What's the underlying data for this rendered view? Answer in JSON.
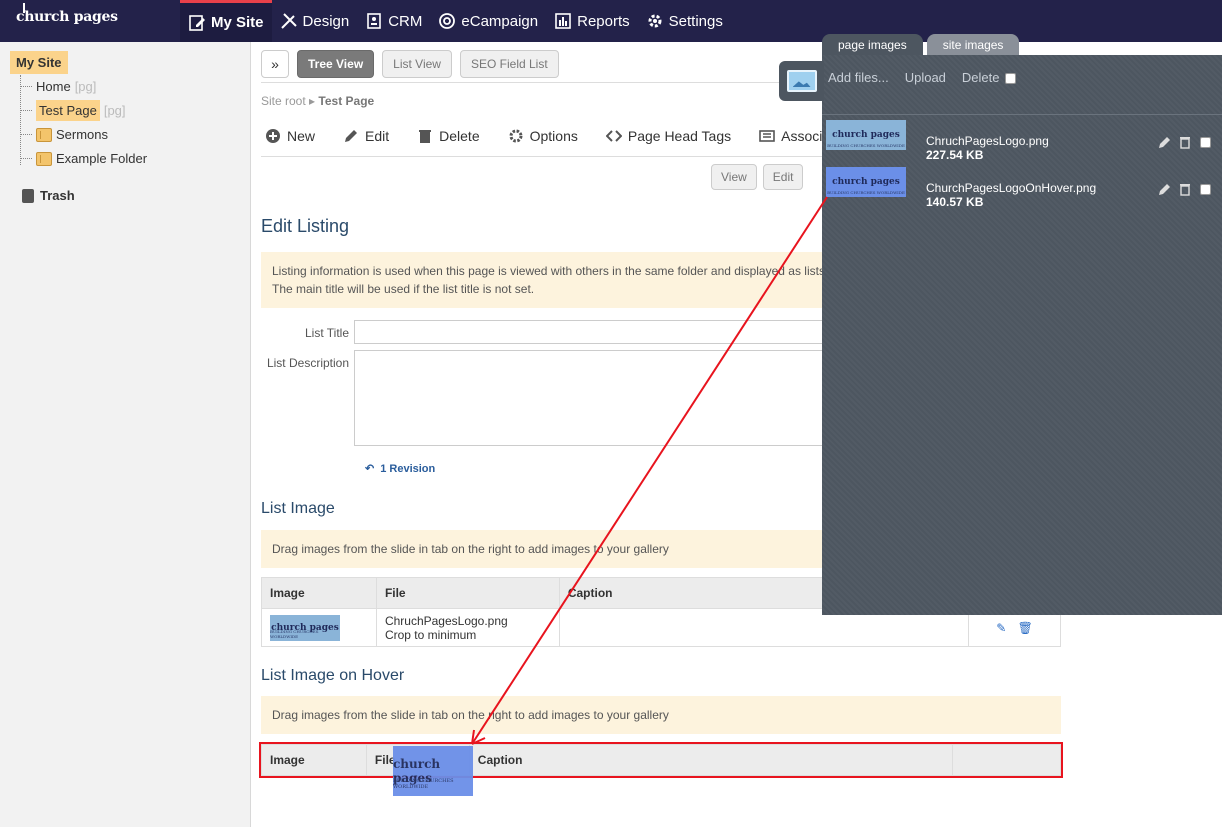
{
  "brand": {
    "name": "church pages"
  },
  "nav": [
    {
      "label": "My Site",
      "icon": "page-edit-icon",
      "active": true
    },
    {
      "label": "Design",
      "icon": "design-tools-icon"
    },
    {
      "label": "CRM",
      "icon": "address-book-icon"
    },
    {
      "label": "eCampaign",
      "icon": "at-sign-icon"
    },
    {
      "label": "Reports",
      "icon": "bar-chart-icon"
    },
    {
      "label": "Settings",
      "icon": "gear-icon"
    }
  ],
  "sidebar": {
    "root": "My Site",
    "items": [
      {
        "label": "Home",
        "tag": "[pg]"
      },
      {
        "label": "Test Page",
        "tag": "[pg]"
      },
      {
        "label": "Sermons"
      },
      {
        "label": "Example Folder"
      }
    ],
    "trash": "Trash"
  },
  "toolbar": {
    "expand": "»",
    "views": [
      "Tree View",
      "List View",
      "SEO Field List"
    ]
  },
  "breadcrumb": {
    "root": "Site root",
    "current": "Test Page"
  },
  "actions": [
    "New",
    "Edit",
    "Delete",
    "Options",
    "Page Head Tags",
    "Associate"
  ],
  "view_buttons": [
    "View",
    "Edit"
  ],
  "edit_listing": {
    "title": "Edit Listing",
    "note_line1": "Listing information is used when this page is viewed with others in the same folder and displayed as lists.",
    "note_line2": "The main title will be used if the list title is not set.",
    "list_title_label": "List Title",
    "list_title_value": "",
    "list_description_label": "List Description",
    "list_description_value": "",
    "revision": "1 Revision"
  },
  "list_image": {
    "title": "List Image",
    "note": "Drag images from the slide in tab on the right to add images to your gallery",
    "headers": [
      "Image",
      "File",
      "Caption",
      ""
    ],
    "rows": [
      {
        "file": "ChruchPagesLogo.png",
        "crop": "Crop to minimum",
        "caption": ""
      }
    ]
  },
  "list_image_hover": {
    "title": "List Image on Hover",
    "note": "Drag images from the slide in tab on the right to add images to your gallery",
    "headers": [
      "Image",
      "File",
      "Caption",
      ""
    ]
  },
  "panel": {
    "tabs": [
      "page images",
      "site images"
    ],
    "add_files": "Add files...",
    "upload": "Upload",
    "delete": "Delete",
    "files": [
      {
        "name": "ChruchPagesLogo.png",
        "size": "227.54 KB"
      },
      {
        "name": "ChurchPagesLogoOnHover.png",
        "size": "140.57 KB"
      }
    ]
  },
  "thumb": {
    "text": "church pages",
    "tagline": "BUILDING CHURCHES WORLDWIDE"
  },
  "colors": {
    "nav_bg": "#23224a",
    "accent": "#e8404a",
    "highlight": "#fbd38b",
    "panel_bg": "#4d5660",
    "arrow": "#e8141e"
  }
}
